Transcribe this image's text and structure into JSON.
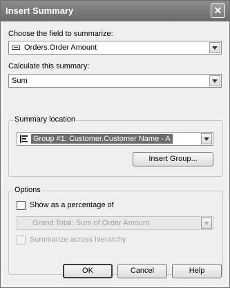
{
  "window": {
    "title": "Insert Summary"
  },
  "field": {
    "label": "Choose the field to summarize:",
    "value": "Orders.Order Amount",
    "icon": "database-field-icon"
  },
  "summary": {
    "label": "Calculate this summary:",
    "value": "Sum"
  },
  "location": {
    "group_title": "Summary location",
    "value": "Group #1: Customer.Customer Name - A",
    "icon": "group-tree-icon",
    "insert_group_label": "Insert Group..."
  },
  "options": {
    "group_title": "Options",
    "percentage_label": "Show as a percentage of",
    "percentage_checked": false,
    "percentage_value": "Grand Total: Sum of Order Amount",
    "hierarchy_label": "Summarize across hierarchy",
    "hierarchy_checked": false
  },
  "buttons": {
    "ok": "OK",
    "cancel": "Cancel",
    "help": "Help"
  }
}
